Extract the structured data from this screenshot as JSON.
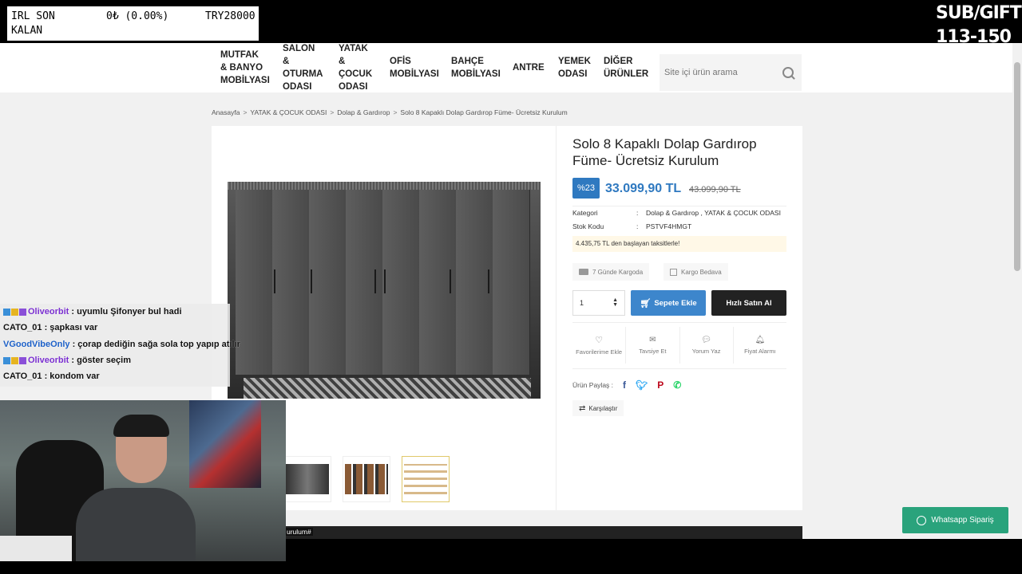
{
  "stream": {
    "irl_title": "IRL SON KALAN",
    "irl_value": "0₺ (0.00%)",
    "irl_goal": "TRY28000",
    "subgift_line1": "SUB/GIFT",
    "subgift_line2": "113-150",
    "chat": [
      {
        "user": "Oliveorbit",
        "message": " : uyumlu Şifonyer bul hadi",
        "color": "purple",
        "badges": true
      },
      {
        "user": "CATO_01",
        "message": " : şapkası var",
        "color": "none",
        "badges": false
      },
      {
        "user": "VGoodVibeOnly",
        "message": " : çorap dediğin sağa sola top yapıp atılır",
        "color": "blue",
        "badges": false
      },
      {
        "user": "Oliveorbit",
        "message": " : göster seçim",
        "color": "purple",
        "badges": true
      },
      {
        "user": "CATO_01",
        "message": " : kondom var",
        "color": "none",
        "badges": false
      }
    ]
  },
  "site": {
    "nav": [
      "MUTFAK & BANYO MOBİLYASI",
      "SALON & OTURMA ODASI",
      "YATAK & ÇOCUK ODASI",
      "OFİS MOBİLYASI",
      "BAHÇE MOBİLYASI",
      "ANTRE",
      "YEMEK ODASI",
      "DİĞER ÜRÜNLER"
    ],
    "search_placeholder": "Site içi ürün arama",
    "breadcrumb": [
      "Anasayfa",
      "YATAK & ÇOCUK ODASI",
      "Dolap & Gardırop",
      "Solo 8 Kapaklı Dolap Gardırop Füme- Ücretsiz Kurulum"
    ],
    "product": {
      "title": "Solo 8 Kapaklı Dolap Gardırop Füme- Ücretsiz Kurulum",
      "discount": "%23",
      "price": "33.099,90 TL",
      "old_price": "43.099,90 TL",
      "category_label": "Kategori",
      "category_value": "Dolap & Gardırop , YATAK & ÇOCUK ODASI",
      "stock_label": "Stok Kodu",
      "stock_value": "PSTVF4HMGT",
      "installment": "4.435,75 TL den başlayan taksitlerle!",
      "shipping_chip": "7 Günde Kargoda",
      "free_shipping_chip": "Kargo Bedava",
      "quantity": "1",
      "add_to_cart": "Sepete Ekle",
      "buy_now": "Hızlı Satın Al",
      "actions": [
        "Favorilerime Ekle",
        "Tavsiye Et",
        "Yorum Yaz",
        "Fiyat Alarmı"
      ],
      "share_label": "Ürün Paylaş :",
      "compare": "Karşılaştır",
      "bottom_label": "urulum#"
    },
    "whatsapp": "Whatsapp Sipariş",
    "colors": {
      "accent": "#2f79c0",
      "whatsapp": "#2aa37c",
      "dark": "#222222"
    }
  }
}
